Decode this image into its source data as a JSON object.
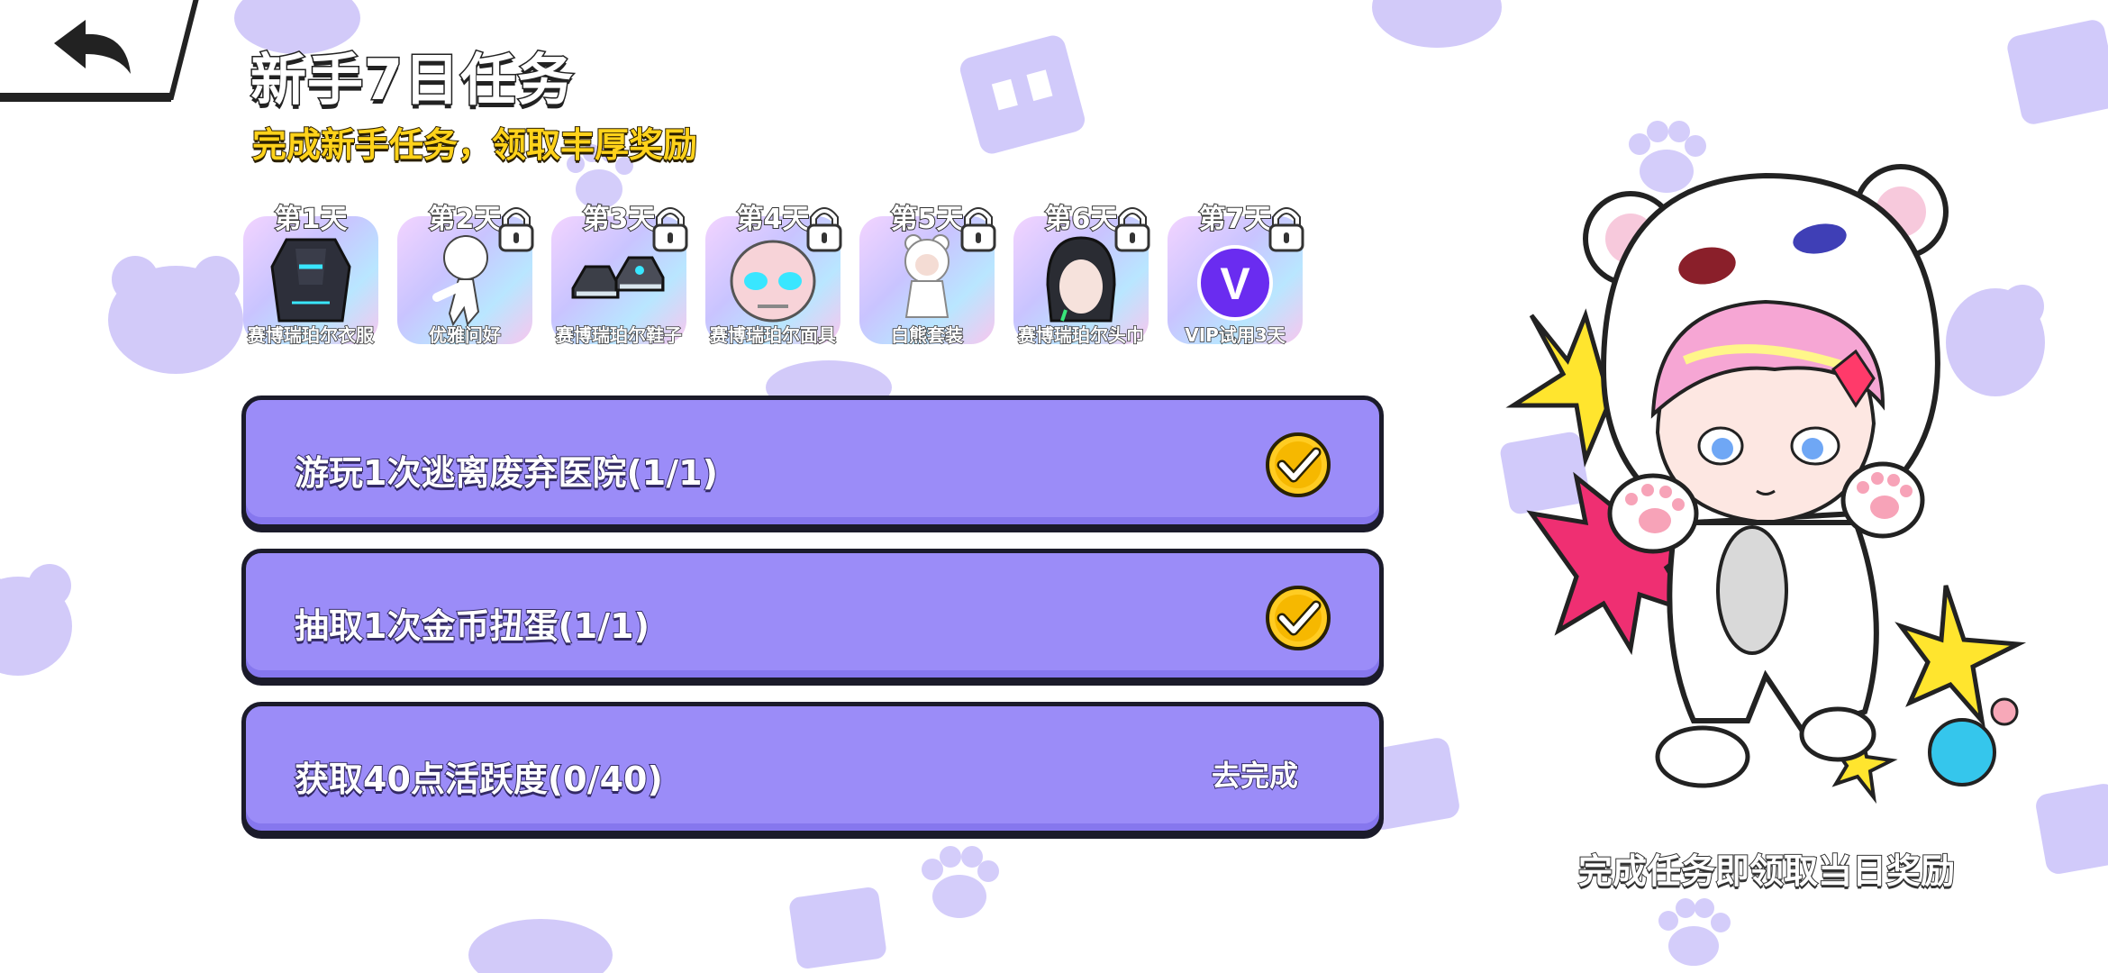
{
  "header": {
    "back_icon": "back-arrow-icon",
    "title": "新手7日任务",
    "subtitle": "完成新手任务，领取丰厚奖励"
  },
  "days": [
    {
      "label": "第1天",
      "item": "赛博瑞珀尔衣服",
      "locked": false,
      "icon": "cyber-outfit-icon"
    },
    {
      "label": "第2天",
      "item": "优雅问好",
      "locked": true,
      "icon": "greeting-pose-icon"
    },
    {
      "label": "第3天",
      "item": "赛博瑞珀尔鞋子",
      "locked": true,
      "icon": "cyber-shoes-icon"
    },
    {
      "label": "第4天",
      "item": "赛博瑞珀尔面具",
      "locked": true,
      "icon": "cyber-mask-icon"
    },
    {
      "label": "第5天",
      "item": "白熊套装",
      "locked": true,
      "icon": "white-bear-suit-icon"
    },
    {
      "label": "第6天",
      "item": "赛博瑞珀尔头巾",
      "locked": true,
      "icon": "cyber-hood-icon"
    },
    {
      "label": "第7天",
      "item": "VIP试用3天",
      "locked": true,
      "icon": "vip-badge-icon",
      "badge_letter": "V"
    }
  ],
  "tasks": [
    {
      "text": "游玩1次逃离废弃医院(1/1)",
      "completed": true
    },
    {
      "text": "抽取1次金币扭蛋(1/1)",
      "completed": true
    },
    {
      "text": "获取40点活跃度(0/40)",
      "completed": false,
      "action": "去完成"
    }
  ],
  "character": {
    "caption": "完成任务即领取当日奖励"
  },
  "colors": {
    "task_bg": "#9b8cf8",
    "subtitle": "#ffd21a",
    "check": "#ffcc22",
    "deco": "#b9adf7"
  }
}
